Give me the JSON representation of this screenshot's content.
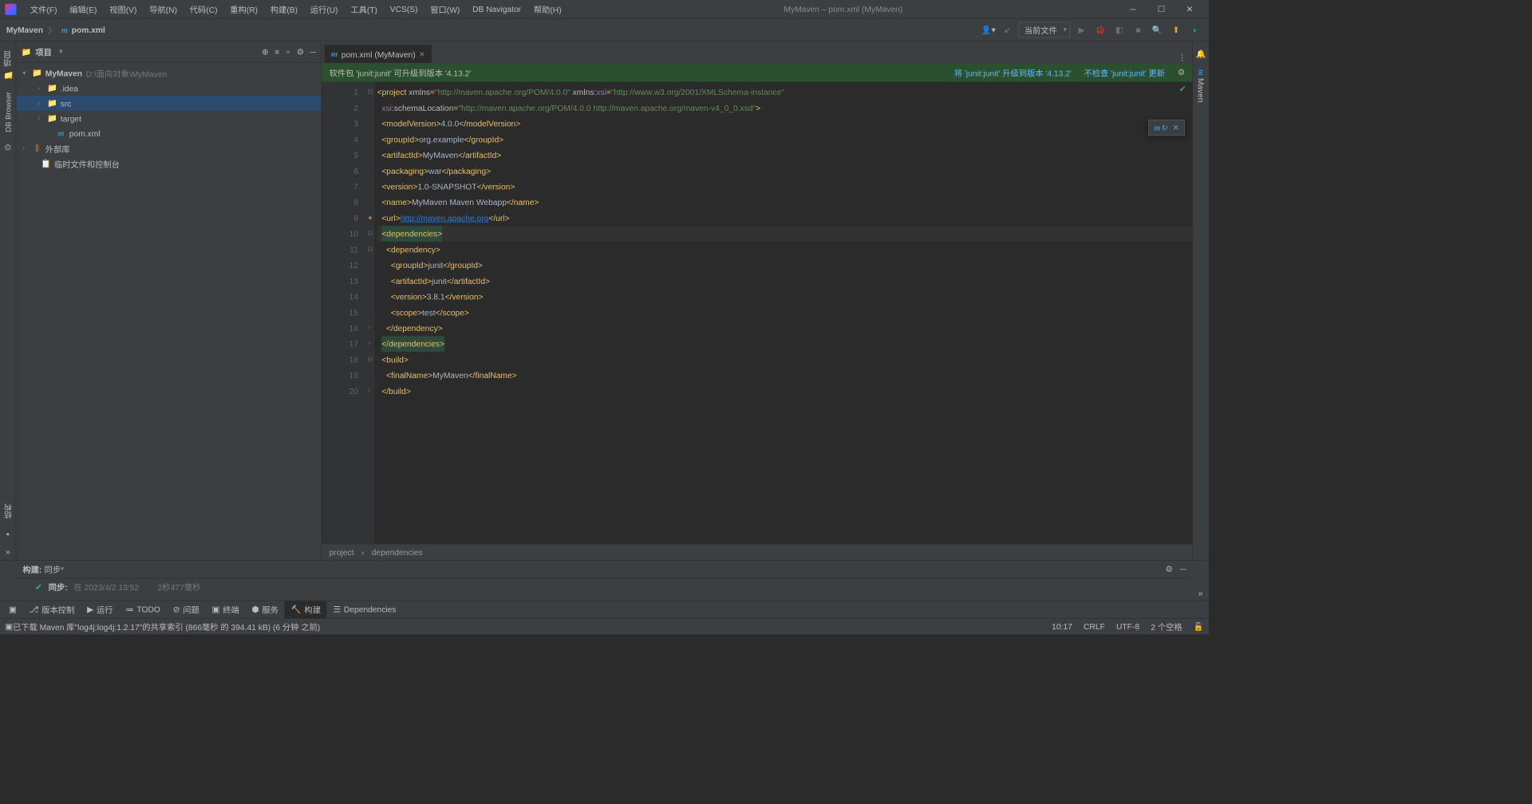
{
  "titlebar": {
    "menus": [
      "文件(F)",
      "编辑(E)",
      "视图(V)",
      "导航(N)",
      "代码(C)",
      "重构(R)",
      "构建(B)",
      "运行(U)",
      "工具(T)",
      "VCS(S)",
      "窗口(W)",
      "DB Navigator",
      "帮助(H)"
    ],
    "title": "MyMaven – pom.xml (MyMaven)"
  },
  "breadcrumb": {
    "root": "MyMaven",
    "file": "pom.xml"
  },
  "runConfig": "当前文件",
  "projectPanel": {
    "title": "项目",
    "tree": {
      "root": {
        "name": "MyMaven",
        "path": "D:\\面向对象\\MyMaven"
      },
      "children": [
        {
          "name": ".idea",
          "kind": "folder-gray"
        },
        {
          "name": "src",
          "kind": "folder-gray",
          "selected": true
        },
        {
          "name": "target",
          "kind": "folder-orange"
        },
        {
          "name": "pom.xml",
          "kind": "maven"
        }
      ],
      "extLibs": "外部库",
      "scratches": "临时文件和控制台"
    }
  },
  "tab": {
    "label": "pom.xml (MyMaven)"
  },
  "notice": {
    "msg": "软件包 'junit:junit' 可升级到版本 '4.13.2'",
    "link1": "将 'junit:junit' 升级到版本 '4.13.2'",
    "link2": "不检查 'junit:junit' 更新"
  },
  "lines": 20,
  "crumbs": {
    "a": "project",
    "b": "dependencies"
  },
  "build": {
    "title": "构建:",
    "sync_label": "同步",
    "sync_bold": "同步:",
    "sync_time": "在 2023/4/2 13:52",
    "sync_dur": "2秒477毫秒"
  },
  "bottomTabs": {
    "vcs": "版本控制",
    "run": "运行",
    "todo": "TODO",
    "problems": "问题",
    "terminal": "终端",
    "services": "服务",
    "build": "构建",
    "deps": "Dependencies"
  },
  "status": {
    "msg": "已下载 Maven 库\"log4j:log4j:1.2.17\"的共享索引 (866毫秒 的 394.41 kB) (6 分钟 之前)",
    "pos": "10:17",
    "eol": "CRLF",
    "enc": "UTF-8",
    "indent": "2 个空格"
  },
  "leftTabs": {
    "project": "项目",
    "db": "DB Browser"
  },
  "rightTabs": {
    "maven": "Maven",
    "notify": "通知"
  },
  "buildLeftTab": "结构",
  "code": {
    "modelVersion": "4.0.0",
    "groupId": "org.example",
    "artifactId": "MyMaven",
    "packaging": "war",
    "version": "1.0-SNAPSHOT",
    "name": "MyMaven Maven Webapp",
    "url": "http://maven.apache.org",
    "depGroupId": "junit",
    "depArtifactId": "junit",
    "depVersion": "3.8.1",
    "depScope": "test",
    "finalName": "MyMaven",
    "xmlns": "http://maven.apache.org/POM/4.0.0",
    "xmlnsXsi": "http://www.w3.org/2001/XMLSchema-instance",
    "schemaLoc": "http://maven.apache.org/POM/4.0.0 http://maven.apache.org/maven-v4_0_0.xsd"
  }
}
